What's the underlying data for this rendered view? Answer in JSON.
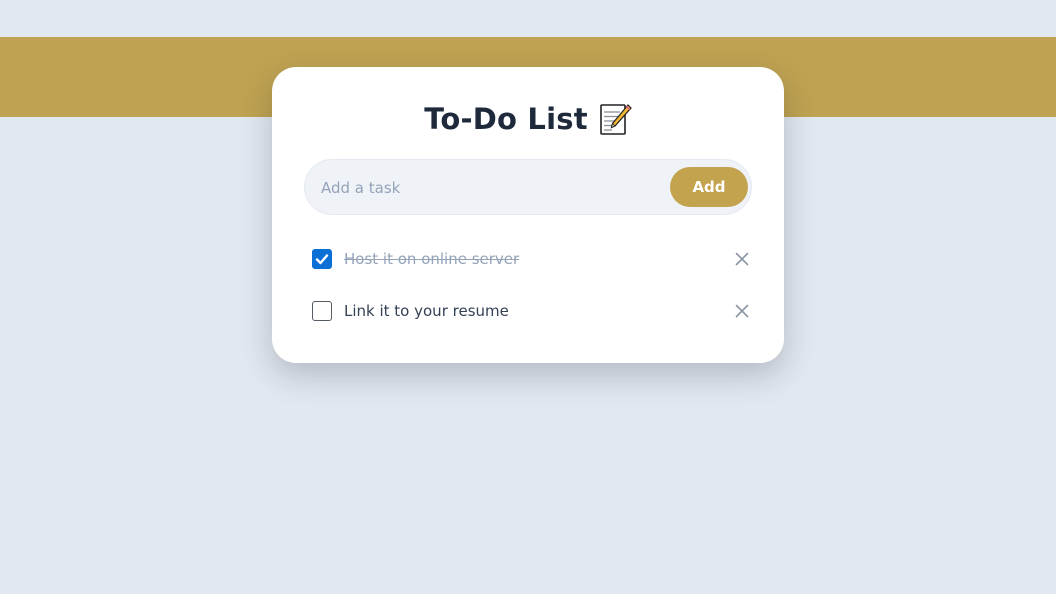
{
  "app": {
    "title": "To-Do List",
    "title_icon": "memo-icon"
  },
  "input": {
    "placeholder": "Add a task",
    "value": "",
    "add_label": "Add"
  },
  "tasks": [
    {
      "label": "Host it on online server",
      "completed": true,
      "delete_icon": "close-icon"
    },
    {
      "label": "Link it to your resume",
      "completed": false,
      "delete_icon": "close-icon"
    }
  ],
  "colors": {
    "background": "#e2e8f0",
    "banner": "#bfa352",
    "accent": "#c4a34f",
    "checkbox_checked": "#0b6fd6",
    "title_text": "#1e293b",
    "muted_text": "#94a3b8"
  }
}
